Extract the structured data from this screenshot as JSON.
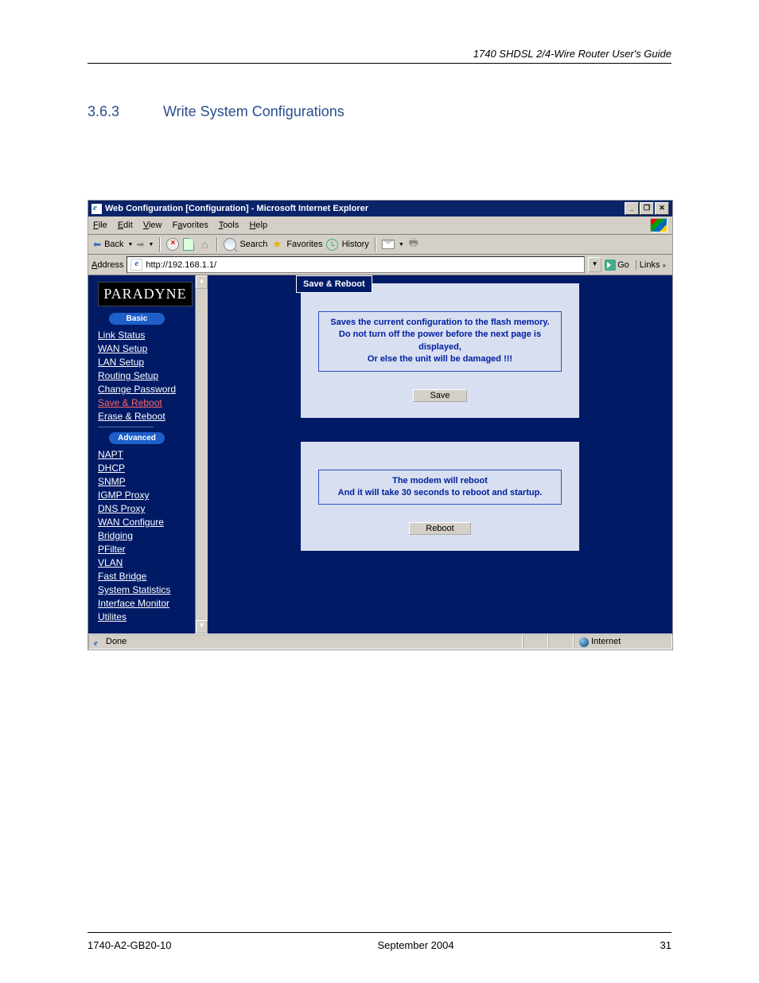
{
  "doc": {
    "running_header": "1740 SHDSL 2/4-Wire Router User's Guide",
    "section_num": "3.6.3",
    "section_title": "Write System Configurations",
    "footer_left": "1740-A2-GB20-10",
    "footer_center": "September 2004",
    "footer_right": "31"
  },
  "ie": {
    "title": "Web Configuration [Configuration] - Microsoft Internet Explorer",
    "menu": {
      "file": "File",
      "edit": "Edit",
      "view": "View",
      "fav": "Favorites",
      "tools": "Tools",
      "help": "Help"
    },
    "toolbar": {
      "back": "Back",
      "search": "Search",
      "favorites": "Favorites",
      "history": "History"
    },
    "address": {
      "label": "Address",
      "url": "http://192.168.1.1/",
      "go": "Go",
      "links": "Links"
    },
    "status": {
      "done": "Done",
      "zone": "Internet"
    }
  },
  "web": {
    "logo": "PARADYNE",
    "pill_basic": "Basic",
    "pill_adv": "Advanced",
    "nav_basic": [
      "Link Status",
      "WAN Setup",
      "LAN Setup",
      "Routing Setup",
      "Change Password",
      "Save & Reboot",
      "Erase & Reboot"
    ],
    "nav_adv": [
      "NAPT",
      "DHCP",
      "SNMP",
      "IGMP Proxy",
      "DNS Proxy",
      "WAN Configure",
      "Bridging",
      "PFilter",
      "VLAN",
      "Fast Bridge",
      "System Statistics",
      "Interface Monitor",
      "Utilites"
    ],
    "panel1": {
      "title": "Save & Reboot",
      "l1": "Saves the current configuration to the flash memory.",
      "l2": "Do not turn off the power before the next page is",
      "l3": "displayed,",
      "l4": "Or else the unit will be damaged !!!",
      "btn": "Save"
    },
    "panel2": {
      "l1": "The modem will reboot",
      "l2": "And it will take 30 seconds to reboot and startup.",
      "btn": "Reboot"
    }
  }
}
